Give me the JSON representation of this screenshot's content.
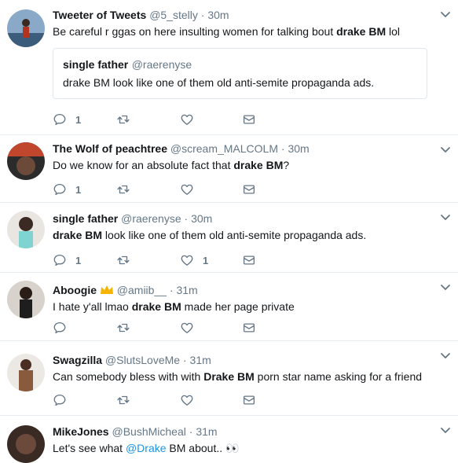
{
  "tweets": [
    {
      "name": "Tweeter of Tweets",
      "handle": "@5_stelly",
      "time": "30m",
      "text_pre": "Be careful r  ggas on here insulting women for talking bout ",
      "text_bold": "drake BM",
      "text_post": " lol",
      "quote": {
        "name": "single father",
        "handle": "@raerenyse",
        "text": "drake BM look like one of them old anti-semite propaganda ads."
      },
      "reply_count": "1",
      "like_count": ""
    },
    {
      "name": "The Wolf of peachtree",
      "handle": "@scream_MALCOLM",
      "time": "30m",
      "text_pre": "Do we know for an absolute fact that ",
      "text_bold": "drake BM",
      "text_post": "?",
      "reply_count": "1",
      "like_count": ""
    },
    {
      "name": "single father",
      "handle": "@raerenyse",
      "time": "30m",
      "text_pre": "",
      "text_bold": "drake BM",
      "text_post": " look like one of them old anti-semite propaganda ads.",
      "reply_count": "1",
      "like_count": "1"
    },
    {
      "name": "Aboogie",
      "handle": "@amiib__",
      "time": "31m",
      "text_pre": "I hate y'all lmao ",
      "text_bold": "drake BM",
      "text_post": " made her page private",
      "reply_count": "",
      "like_count": ""
    },
    {
      "name": "Swagzilla",
      "handle": "@SlutsLoveMe",
      "time": "31m",
      "text_pre": "Can somebody bless with with ",
      "text_bold": "Drake BM",
      "text_post": " porn star name asking for a friend",
      "reply_count": "",
      "like_count": ""
    },
    {
      "name": "MikeJones",
      "handle": "@BushMicheal",
      "time": "31m",
      "text_pre": "Let's see what ",
      "mention": "@Drake",
      "text_post": " BM about.. ",
      "emoji": "👀",
      "reply_count": "",
      "like_count": ""
    }
  ],
  "separator": "·",
  "colors": {
    "name": "#14171a",
    "meta": "#657786",
    "link": "#1b95e0",
    "divider": "#e6ecf0",
    "icon": "#657786",
    "crown": "#f5b400"
  },
  "icons": {
    "reply": "reply-icon",
    "retweet": "retweet-icon",
    "like": "heart-icon",
    "dm": "envelope-icon",
    "menu": "chevron-down-icon"
  }
}
